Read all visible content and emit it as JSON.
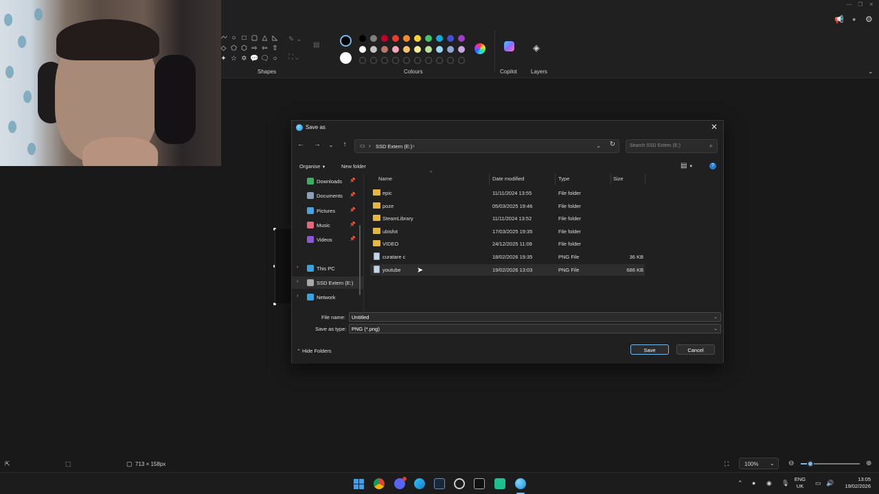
{
  "ribbon": {
    "shapes_label": "Shapes",
    "colours_label": "Colours",
    "copilot_label": "Copilot",
    "layers_label": "Layers",
    "colors_row1": [
      "#000000",
      "#7f7f7f",
      "#c00026",
      "#e63b2e",
      "#f28a30",
      "#f7d336",
      "#3fc46a",
      "#18a7d8",
      "#3f51d0",
      "#9b3fc6"
    ],
    "colors_row2": [
      "#ffffff",
      "#c3c3c3",
      "#b6796a",
      "#f4a8b6",
      "#f8c56a",
      "#f4ec9a",
      "#b5e39a",
      "#9ad7ee",
      "#8fa6d6",
      "#c8a6de"
    ],
    "primary_color": "#000000",
    "secondary_color": "#ffffff"
  },
  "dialog": {
    "title": "Save as",
    "address": {
      "path_label": "SSD Extern (E:)",
      "separator": "›"
    },
    "search_placeholder": "Search SSD Extern (E:)",
    "toolbar": {
      "organise": "Organise",
      "new_folder": "New folder"
    },
    "nav_items": [
      {
        "label": "Downloads",
        "icon": "download-icon",
        "color": "#3fae61",
        "pinned": true
      },
      {
        "label": "Documents",
        "icon": "document-icon",
        "color": "#8ca0b6",
        "pinned": true
      },
      {
        "label": "Pictures",
        "icon": "picture-icon",
        "color": "#4aa3df",
        "pinned": true
      },
      {
        "label": "Music",
        "icon": "music-icon",
        "color": "#e06a7a",
        "pinned": true
      },
      {
        "label": "Videos",
        "icon": "video-icon",
        "color": "#8a5ad6",
        "pinned": true
      }
    ],
    "nav_locations": [
      {
        "label": "This PC",
        "icon": "pc-icon",
        "color": "#3fa2e0"
      },
      {
        "label": "SSD Extern (E:)",
        "icon": "drive-icon",
        "color": "#a9a9a9"
      },
      {
        "label": "Network",
        "icon": "network-icon",
        "color": "#3fa2e0"
      }
    ],
    "columns": {
      "name": "Name",
      "date": "Date modified",
      "type": "Type",
      "size": "Size"
    },
    "files": [
      {
        "name": "epic",
        "date": "11/11/2024 13:55",
        "type": "File folder",
        "size": "",
        "kind": "folder"
      },
      {
        "name": "poze",
        "date": "05/03/2025 19:46",
        "type": "File folder",
        "size": "",
        "kind": "folder"
      },
      {
        "name": "SteamLibrary",
        "date": "11/11/2024 13:52",
        "type": "File folder",
        "size": "",
        "kind": "folder"
      },
      {
        "name": "ubisfot",
        "date": "17/03/2025 19:35",
        "type": "File folder",
        "size": "",
        "kind": "folder"
      },
      {
        "name": "VIDEO",
        "date": "24/12/2025 11:09",
        "type": "File folder",
        "size": "",
        "kind": "folder"
      },
      {
        "name": "curatare c",
        "date": "18/02/2026 19:35",
        "type": "PNG File",
        "size": "36 KB",
        "kind": "file"
      },
      {
        "name": "youtube",
        "date": "19/02/2026 13:03",
        "type": "PNG File",
        "size": "686 KB",
        "kind": "file"
      }
    ],
    "file_name_label": "File name:",
    "file_name_value": "Untitled",
    "save_type_label": "Save as type:",
    "save_type_value": "PNG (*.png)",
    "hide_folders": "Hide Folders",
    "save_button": "Save",
    "cancel_button": "Cancel"
  },
  "status_bar": {
    "selection_size": "713 × 158px",
    "zoom": "100%"
  },
  "tray": {
    "language_top": "ENG",
    "language_bottom": "UK",
    "time": "13:05",
    "date": "19/02/2026"
  }
}
